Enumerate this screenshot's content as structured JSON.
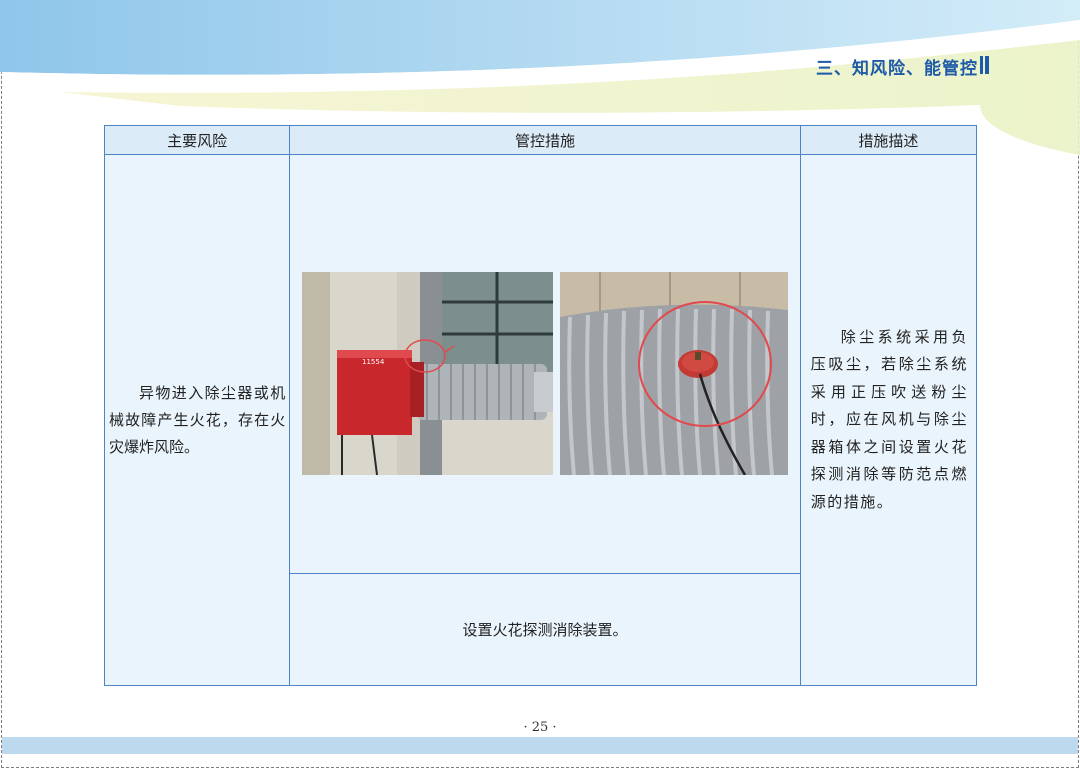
{
  "header": {
    "section_title": "三、知风险、能管控"
  },
  "table": {
    "columns": [
      "主要风险",
      "管控措施",
      "措施描述"
    ],
    "row": {
      "risk": "异物进入除尘器或机械故障产生火花，存在火灾爆炸风险。",
      "measure_caption": "设置火花探测消除装置。",
      "description": "除尘系统采用负压吸尘，若除尘系统采用正压吹送粉尘时，应在风机与除尘器箱体之间设置火花探测消除等防范点燃源的措施。"
    },
    "photos": [
      {
        "name": "spark-detector-on-dust-duct-photo",
        "label": "11554"
      },
      {
        "name": "spark-detector-closeup-photo"
      }
    ]
  },
  "footer": {
    "page_number": "· 25 ·"
  }
}
